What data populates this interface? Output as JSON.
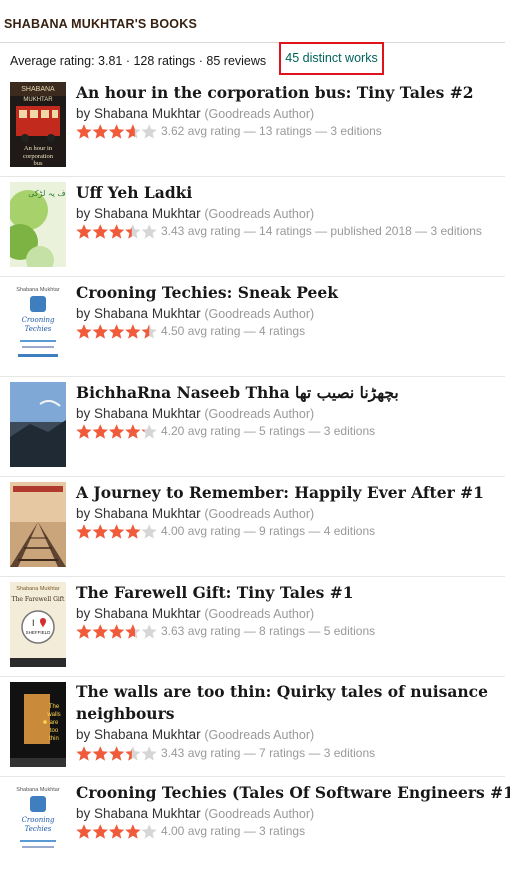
{
  "section": {
    "title": "SHABANA MUKHTAR'S BOOKS",
    "stats": "Average rating: 3.81 · 128 ratings · 85 reviews",
    "distinct_works": "45 distinct works"
  },
  "colors": {
    "star": "#f15a3a",
    "star_empty": "#d6d6d6",
    "link": "#00635d",
    "highlight": "#e0131c"
  },
  "books": [
    {
      "title": "An hour in the corporation bus: Tiny Tales #2",
      "author": "Shabana Mukhtar",
      "author_tag": "(Goodreads Author)",
      "rating": 3.62,
      "meta": "3.62 avg rating — 13 ratings — 3 editions",
      "cover": {
        "top_text": "SHABANA",
        "sub_text": "MUKHTAR",
        "text": "An hour in corporation bus"
      }
    },
    {
      "title": "Uff Yeh Ladki",
      "author": "Shabana Mukhtar",
      "author_tag": "(Goodreads Author)",
      "rating": 3.43,
      "meta": "3.43 avg rating — 14 ratings — published 2018 — 3 editions",
      "cover": {
        "top_text": "اف یہ لڑکی"
      }
    },
    {
      "title": "Crooning Techies: Sneak Peek",
      "author": "Shabana Mukhtar",
      "author_tag": "(Goodreads Author)",
      "rating": 4.5,
      "meta": "4.50 avg rating — 4 ratings",
      "cover": {
        "top_text": "Shabana Mukhtar",
        "text": "Crooning Techies"
      }
    },
    {
      "title": "BichhaRna Naseeb Thha بچھڑنا نصیب تھا",
      "author": "Shabana Mukhtar",
      "author_tag": "(Goodreads Author)",
      "rating": 4.2,
      "meta": "4.20 avg rating — 5 ratings — 3 editions",
      "cover": {}
    },
    {
      "title": "A Journey to Remember: Happily Ever After #1",
      "author": "Shabana Mukhtar",
      "author_tag": "(Goodreads Author)",
      "rating": 4.0,
      "meta": "4.00 avg rating — 9 ratings — 4 editions",
      "cover": {}
    },
    {
      "title": "The Farewell Gift: Tiny Tales #1",
      "author": "Shabana Mukhtar",
      "author_tag": "(Goodreads Author)",
      "rating": 3.63,
      "meta": "3.63 avg rating — 8 ratings — 5 editions",
      "cover": {
        "top_text": "Shabana Mukhtar",
        "text": "The Farewell Gift",
        "sub_text": "SHEFFIELD"
      }
    },
    {
      "title": "The walls are too thin: Quirky tales of nuisance neighbours",
      "author": "Shabana Mukhtar",
      "author_tag": "(Goodreads Author)",
      "rating": 3.43,
      "meta": "3.43 avg rating — 7 ratings — 3 editions",
      "cover": {
        "text": "The walls are too thin"
      }
    },
    {
      "title": "Crooning Techies (Tales Of Software Engineers #1)",
      "author": "Shabana Mukhtar",
      "author_tag": "(Goodreads Author)",
      "rating": 4.0,
      "meta": "4.00 avg rating — 3 ratings",
      "cover": {
        "top_text": "Shabana Mukhtar",
        "text": "Crooning Techies"
      }
    }
  ]
}
